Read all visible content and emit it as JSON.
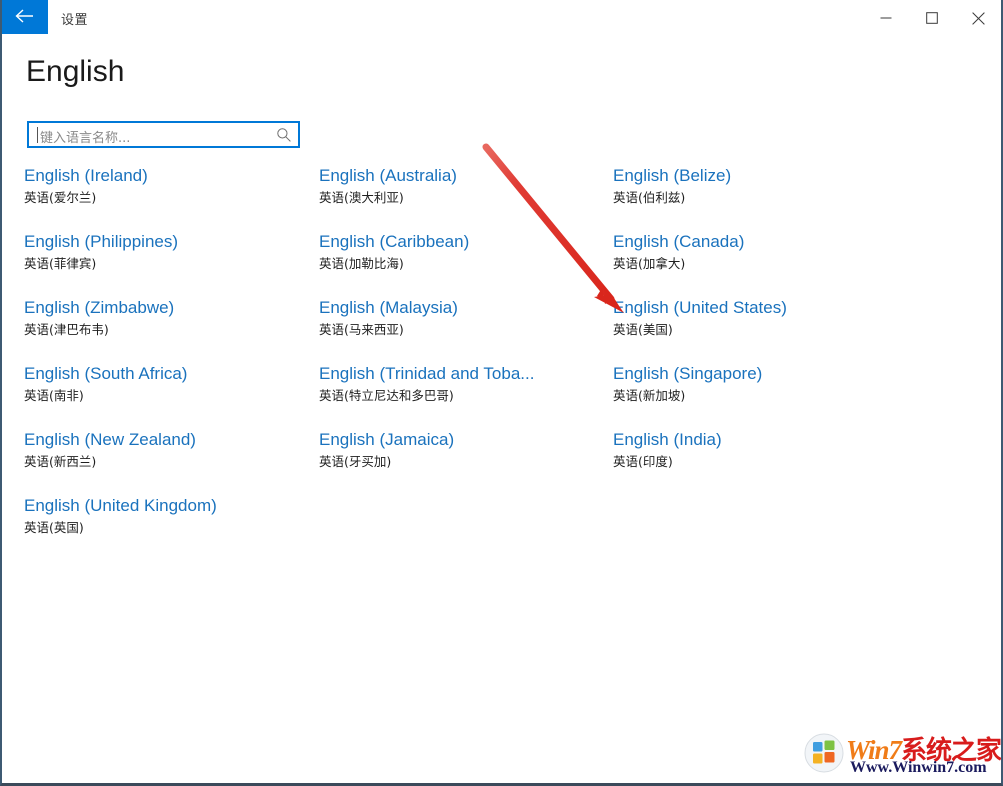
{
  "window": {
    "title": "设置",
    "back_icon": "back-arrow-icon",
    "controls": {
      "minimize": "minimize-icon",
      "maximize": "maximize-icon",
      "close": "close-icon"
    },
    "border_color": "#3d5a73",
    "accent_color": "#0078d7"
  },
  "page": {
    "title": "English"
  },
  "search": {
    "placeholder": "键入语言名称...",
    "value": "",
    "icon": "search-icon",
    "focused": true,
    "border_color": "#0078d7"
  },
  "languages": {
    "link_color": "#1a72bd",
    "columns": [
      {
        "items": [
          {
            "english": "English (Ireland)",
            "chinese": "英语(爱尔兰)"
          },
          {
            "english": "English (Philippines)",
            "chinese": "英语(菲律宾)"
          },
          {
            "english": "English (Zimbabwe)",
            "chinese": "英语(津巴布韦)"
          },
          {
            "english": "English (South Africa)",
            "chinese": "英语(南非)"
          },
          {
            "english": "English (New Zealand)",
            "chinese": "英语(新西兰)"
          },
          {
            "english": "English (United Kingdom)",
            "chinese": "英语(英国)"
          }
        ]
      },
      {
        "items": [
          {
            "english": "English (Australia)",
            "chinese": "英语(澳大利亚)"
          },
          {
            "english": "English (Caribbean)",
            "chinese": "英语(加勒比海)"
          },
          {
            "english": "English (Malaysia)",
            "chinese": "英语(马来西亚)"
          },
          {
            "english": "English (Trinidad and Toba...",
            "chinese": "英语(特立尼达和多巴哥)"
          },
          {
            "english": "English (Jamaica)",
            "chinese": "英语(牙买加)"
          }
        ]
      },
      {
        "items": [
          {
            "english": "English (Belize)",
            "chinese": "英语(伯利兹)"
          },
          {
            "english": "English (Canada)",
            "chinese": "英语(加拿大)"
          },
          {
            "english": "English (United States)",
            "chinese": "英语(美国)"
          },
          {
            "english": "English (Singapore)",
            "chinese": "英语(新加坡)"
          },
          {
            "english": "English (India)",
            "chinese": "英语(印度)"
          }
        ]
      }
    ]
  },
  "annotation": {
    "type": "red-arrow",
    "color": "#e03131",
    "points_to": "English (United States)"
  },
  "watermark": {
    "brand_win": "Win7",
    "brand_cn": "系统之家",
    "url": "Www.Winwin7.com",
    "logo": "windows-orb-icon",
    "orange": "#f07c18",
    "red": "#d81c1c",
    "navy": "#1b1b5e"
  }
}
